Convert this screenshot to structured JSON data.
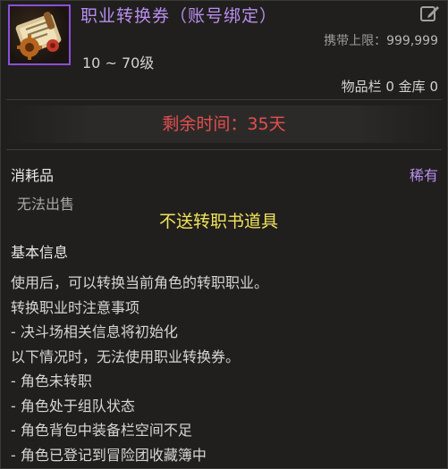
{
  "item": {
    "title": "职业转换券（账号绑定）",
    "icon": "scroll-gear-icon",
    "carry_limit_label": "携带上限：",
    "carry_limit_value": "999,999",
    "level_range": "10 ~ 70级",
    "inventory_info": "物品栏 0 金库 0"
  },
  "time": {
    "remaining": "剩余时间：35天"
  },
  "category": {
    "type": "消耗品",
    "rarity": "稀有",
    "trade": "无法出售",
    "notice": "不送转职书道具"
  },
  "basic_info": {
    "title": "基本信息",
    "lines": [
      "使用后，可以转换当前角色的转职职业。",
      "转换职业时注意事项",
      "- 决斗场相关信息将初始化",
      "以下情况时，无法使用职业转换券。",
      "- 角色未转职",
      "- 角色处于组队状态",
      "- 角色背包中装备栏空间不足",
      "- 角色已登记到冒险团收藏簿中"
    ]
  },
  "colors": {
    "title_purple": "#b98df0",
    "time_red": "#e24f4f",
    "notice_yellow": "#f2e35a",
    "background": "#201f1d"
  }
}
